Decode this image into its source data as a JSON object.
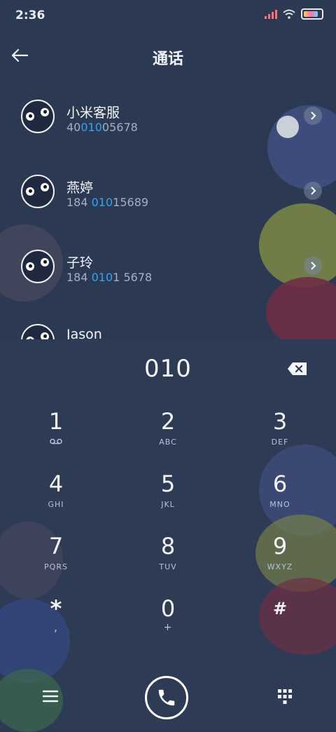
{
  "status_bar": {
    "time": "2:36"
  },
  "header": {
    "title": "通话"
  },
  "contacts": [
    {
      "name": "小米客服",
      "number_pre": "40",
      "number_match": "010",
      "number_post": "05678"
    },
    {
      "name": "燕婷",
      "number_pre": "184 ",
      "number_match": "010",
      "number_post": "15689"
    },
    {
      "name": "子玲",
      "number_pre": "184 ",
      "number_match": "010",
      "number_post": "1 5678"
    },
    {
      "name": "Jason",
      "number_pre": "",
      "number_match": "",
      "number_post": ""
    }
  ],
  "dialer": {
    "input": "010",
    "keys": [
      {
        "digit": "1",
        "letters": ""
      },
      {
        "digit": "2",
        "letters": "ABC"
      },
      {
        "digit": "3",
        "letters": "DEF"
      },
      {
        "digit": "4",
        "letters": "GHI"
      },
      {
        "digit": "5",
        "letters": "JKL"
      },
      {
        "digit": "6",
        "letters": "MNO"
      },
      {
        "digit": "7",
        "letters": "PQRS"
      },
      {
        "digit": "8",
        "letters": "TUV"
      },
      {
        "digit": "9",
        "letters": "WXYZ"
      },
      {
        "digit": "*",
        "letters": ","
      },
      {
        "digit": "0",
        "letters": "+"
      },
      {
        "digit": "#",
        "letters": ""
      }
    ]
  },
  "icons": {
    "back": "arrow-left-icon",
    "chevron": "chevron-right-icon",
    "backspace": "backspace-icon",
    "voicemail": "voicemail-icon",
    "menu": "menu-icon",
    "call": "phone-icon",
    "keypad": "keypad-grid-icon"
  },
  "colors": {
    "background": "#2b3953",
    "match_highlight": "#2fa6f3",
    "text": "#f4f6fb",
    "subtext": "#a4b0c4"
  }
}
